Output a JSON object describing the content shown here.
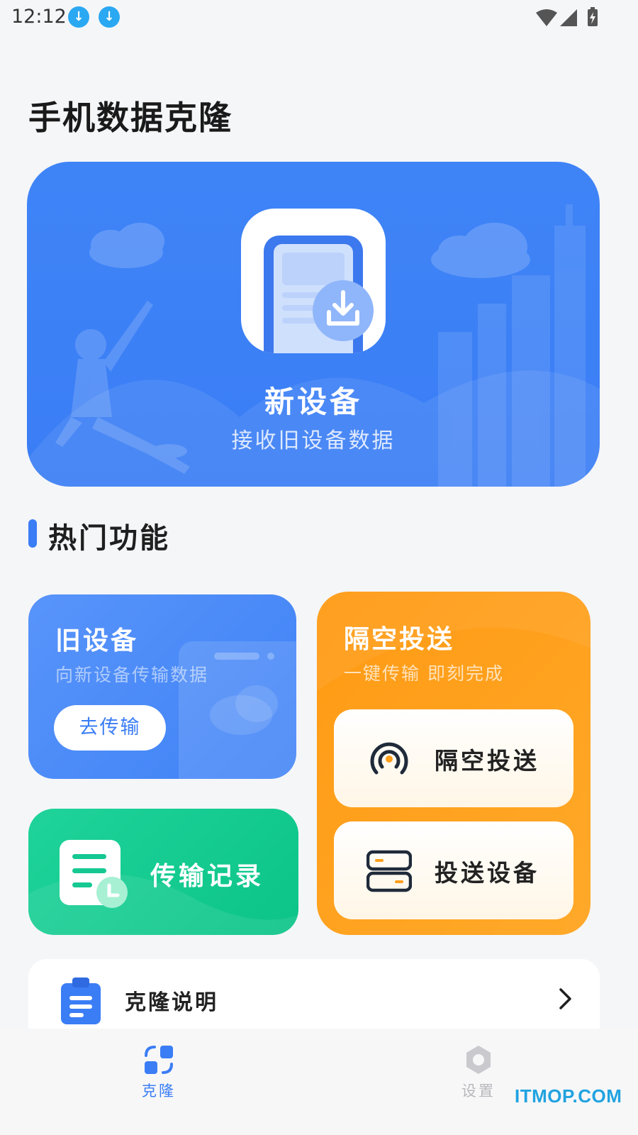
{
  "status_bar": {
    "time": "12:12",
    "notification_icons": [
      "download-icon",
      "download-icon"
    ],
    "system_icons": [
      "wifi-icon",
      "signal-icon",
      "battery-charging-icon"
    ]
  },
  "page": {
    "title": "手机数据克隆"
  },
  "hero": {
    "title": "新设备",
    "subtitle": "接收旧设备数据",
    "icon": "phone-download-icon",
    "color": "#3a7df5"
  },
  "section": {
    "title": "热门功能"
  },
  "old_device": {
    "title": "旧设备",
    "subtitle": "向新设备传输数据",
    "button_label": "去传输",
    "color": "#4a88f7"
  },
  "records": {
    "label": "传输记录",
    "icon": "document-clock-icon",
    "color": "#12c98e"
  },
  "airdrop": {
    "title": "隔空投送",
    "subtitle": "一键传输 即刻完成",
    "color": "#ff9f1c",
    "options": [
      {
        "label": "隔空投送",
        "icon": "broadcast-icon"
      },
      {
        "label": "投送设备",
        "icon": "server-icon"
      }
    ]
  },
  "guide": {
    "label": "克隆说明",
    "icon": "clipboard-icon"
  },
  "bottom_nav": {
    "items": [
      {
        "label": "克隆",
        "icon": "clone-icon",
        "active": true
      },
      {
        "label": "设置",
        "icon": "settings-icon",
        "active": false
      }
    ]
  },
  "watermark": "ITMOP.COM"
}
